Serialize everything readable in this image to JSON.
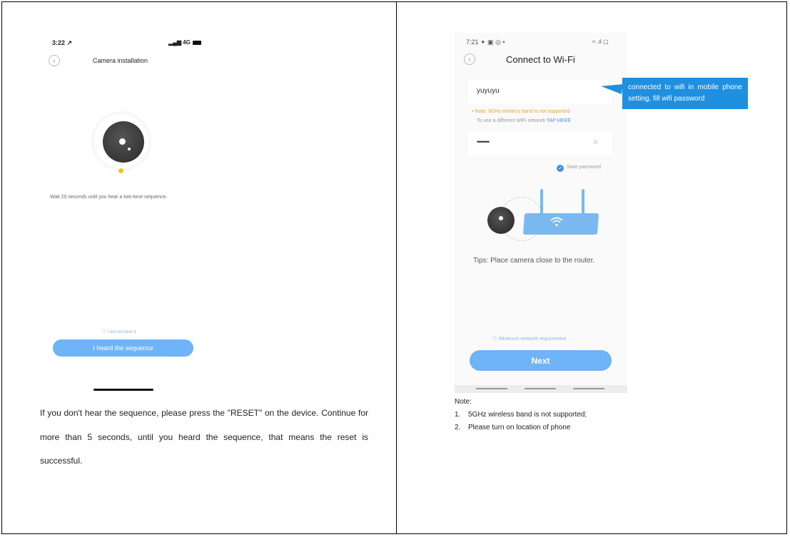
{
  "left": {
    "status_time": "3:22 ↗",
    "status_signal": "▂▄▆ 4G",
    "back_icon": "chevron-left-icon",
    "title": "Camera installation",
    "wait_text": "Wait 20 seconds until you hear a two-tone sequence.",
    "didnt_hear": "ⓘ I did not hear it",
    "button_label": "I heard the sequence",
    "paragraph": "If you don't hear the sequence, please press the \"RESET\" on the device. Continue for more than 5 seconds, until you heard the sequence, that means the reset is successful."
  },
  "right": {
    "status_time": "7:21 ✦ ▣ ◎ •",
    "status_right": "≈ .ıl ▢",
    "title": "Connect to Wi-Fi",
    "ssid": "yuyuyu",
    "note_5g": "• Note: 5GHz wireless band is not supported",
    "note_diff": "To use a different WiFi network ",
    "tap_here": "TAP HERE",
    "password_mask": "••••••••",
    "clear_icon": "✕",
    "save_password": "Save password",
    "callout": "connected to wifi in mobile phone setting, fill wifi password",
    "tips": "Tips: Place camera close to the router.",
    "min_req": "ⓘ Minimum network requirement",
    "next_label": "Next",
    "note_heading": "Note:",
    "notes": [
      {
        "num": "1.",
        "text": "5GHz wireless band is not supported;"
      },
      {
        "num": "2.",
        "text": "Please turn on location of phone"
      }
    ]
  },
  "colors": {
    "accent": "#6eb4f7",
    "callout": "#1f8fe0",
    "warning": "#f0a030",
    "led": "#f5c518"
  }
}
